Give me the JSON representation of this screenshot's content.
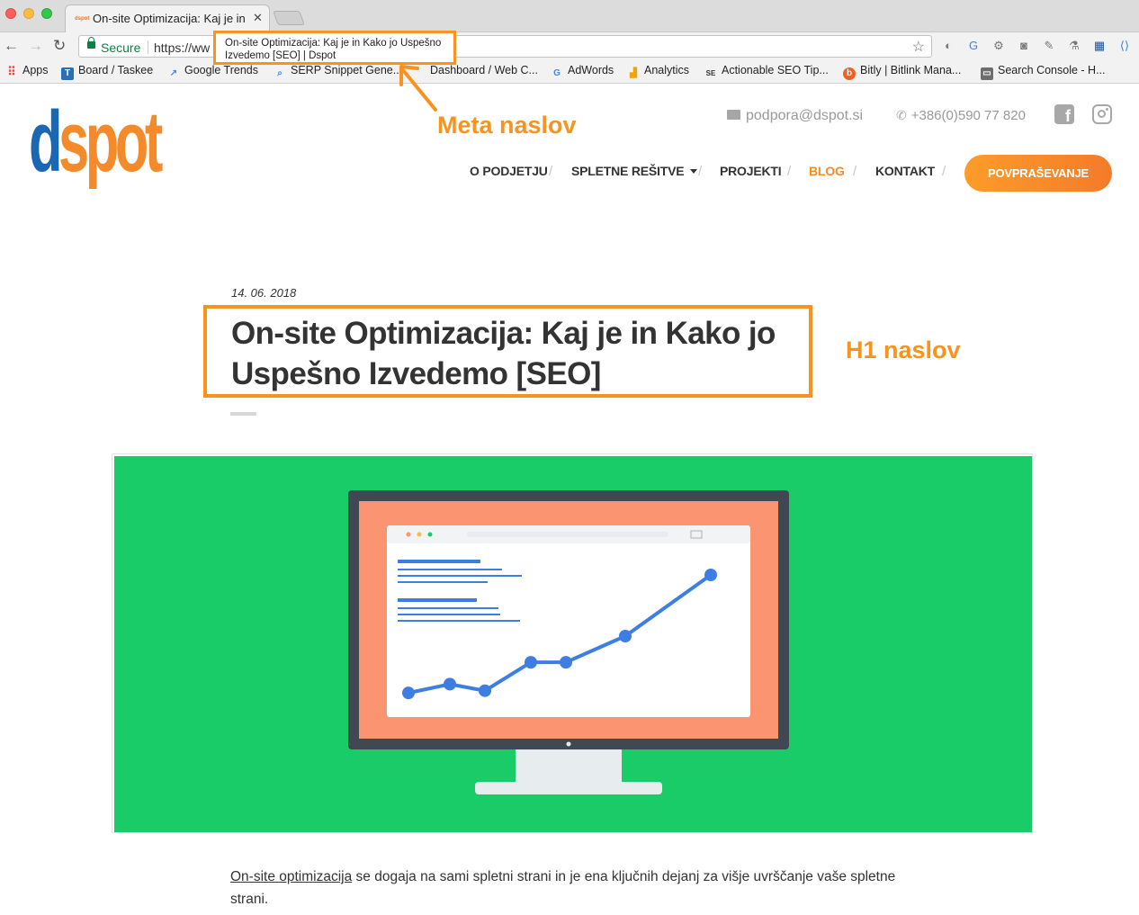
{
  "browser": {
    "tab_title": "On-site Optimizacija: Kaj je in Kako jo Uspešno Izvedemo [SEO] | Dspot",
    "tab_favicon_text": "dspot",
    "secure_label": "Secure",
    "url_visible": "https://ww",
    "tooltip_line1": "On-site Optimizacija: Kaj je in Kako jo Uspešno",
    "tooltip_line2": "Izvedemo [SEO] | Dspot",
    "bookmarks": [
      {
        "label": "Apps",
        "icon": "apps-grid-icon",
        "color": "#e8453c"
      },
      {
        "label": "Board / Taskee",
        "icon": "taskee-icon",
        "color": "#2a6ebb"
      },
      {
        "label": "Google Trends",
        "icon": "trends-icon",
        "color": "#4285f4"
      },
      {
        "label": "SERP Snippet Gene...",
        "icon": "search-icon",
        "color": "#4285f4"
      },
      {
        "label": "Dashboard / Web C...",
        "icon": "dashboard-icon",
        "color": "#999999"
      },
      {
        "label": "AdWords",
        "icon": "google-icon",
        "color": "#4285f4"
      },
      {
        "label": "Analytics",
        "icon": "analytics-icon",
        "color": "#f4a300"
      },
      {
        "label": "Actionable SEO Tip...",
        "icon": "sej-icon",
        "color": "#333333"
      },
      {
        "label": "Bitly | Bitlink Mana...",
        "icon": "bitly-icon",
        "color": "#ee6123"
      },
      {
        "label": "Search Console - H...",
        "icon": "search-console-icon",
        "color": "#6d6d6d"
      }
    ]
  },
  "annotations": {
    "meta_label": "Meta naslov",
    "h1_label": "H1 naslov",
    "accent_color": "#f7931e"
  },
  "site": {
    "logo_d": "d",
    "logo_rest": "spot",
    "email": "podpora@dspot.si",
    "phone": "+386(0)590 77 820",
    "nav": [
      {
        "label": "O PODJETJU"
      },
      {
        "label": "SPLETNE REŠITVE"
      },
      {
        "label": "PROJEKTI"
      },
      {
        "label": "BLOG"
      },
      {
        "label": "KONTAKT"
      }
    ],
    "cta_label": "POVPRAŠEVANJE",
    "brand_orange": "#f48a2a",
    "brand_blue": "#1a67b3"
  },
  "article": {
    "date": "14. 06. 2018",
    "title": "On-site Optimizacija: Kaj je in Kako jo Uspešno Izvedemo [SEO]",
    "intro_link": "On-site optimizacija",
    "intro_rest": " se dogaja na sami spletni strani in je ena ključnih dejanj za višje uvrščanje vaše spletne strani."
  },
  "hero_chart": {
    "type": "line",
    "values": [
      1,
      3,
      1.5,
      8,
      8,
      14,
      28
    ]
  }
}
